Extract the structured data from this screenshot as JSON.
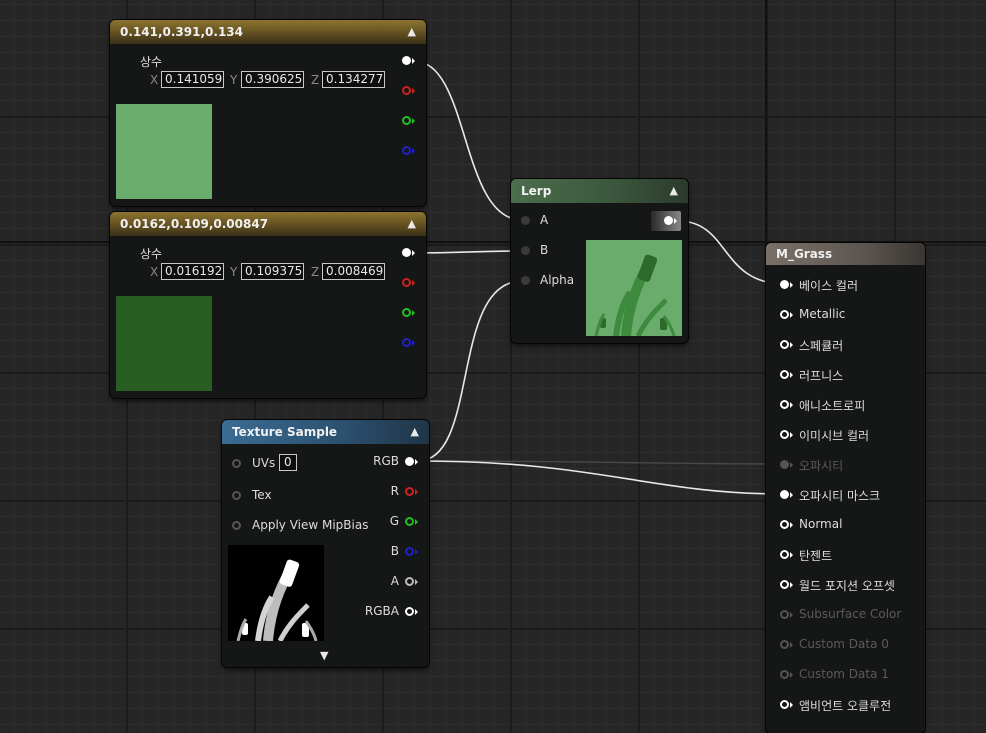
{
  "colors": {
    "grid": "#262626",
    "const1_swatch": "#6aac6c",
    "const2_swatch": "#285e22",
    "lerp_preview": "#6aac6c",
    "pin_red": "#d02020",
    "pin_green": "#20c020",
    "pin_blue": "#2020d0"
  },
  "const1": {
    "title": "0.141,0.391,0.134",
    "label": "상수",
    "x_label": "X",
    "x": "0.141059",
    "y_label": "Y",
    "y": "0.390625",
    "z_label": "Z",
    "z": "0.134277"
  },
  "const2": {
    "title": "0.0162,0.109,0.00847",
    "label": "상수",
    "x_label": "X",
    "x": "0.016192",
    "y_label": "Y",
    "y": "0.109375",
    "z_label": "Z",
    "z": "0.008469"
  },
  "lerp": {
    "title": "Lerp",
    "pins": [
      "A",
      "B",
      "Alpha"
    ]
  },
  "texture_sample": {
    "title": "Texture Sample",
    "inputs": [
      "UVs",
      "Tex",
      "Apply View MipBias"
    ],
    "uvs_value": "0",
    "outputs": [
      "RGB",
      "R",
      "G",
      "B",
      "A",
      "RGBA"
    ]
  },
  "material": {
    "title": "M_Grass",
    "pins": [
      "베이스 컬러",
      "Metallic",
      "스페큘러",
      "러프니스",
      "애니소트로피",
      "이미시브 컬러",
      "오파시티",
      "오파시티 마스크",
      "Normal",
      "탄젠트",
      "월드 포지션 오프셋",
      "Subsurface Color",
      "Custom Data 0",
      "Custom Data 1",
      "앰비언트 오클루전"
    ],
    "disabled_pins": [
      "오파시티",
      "Subsurface Color",
      "Custom Data 0",
      "Custom Data 1"
    ]
  },
  "icons": {
    "collapse": "chevron-up-icon",
    "expand": "chevron-down-icon"
  }
}
